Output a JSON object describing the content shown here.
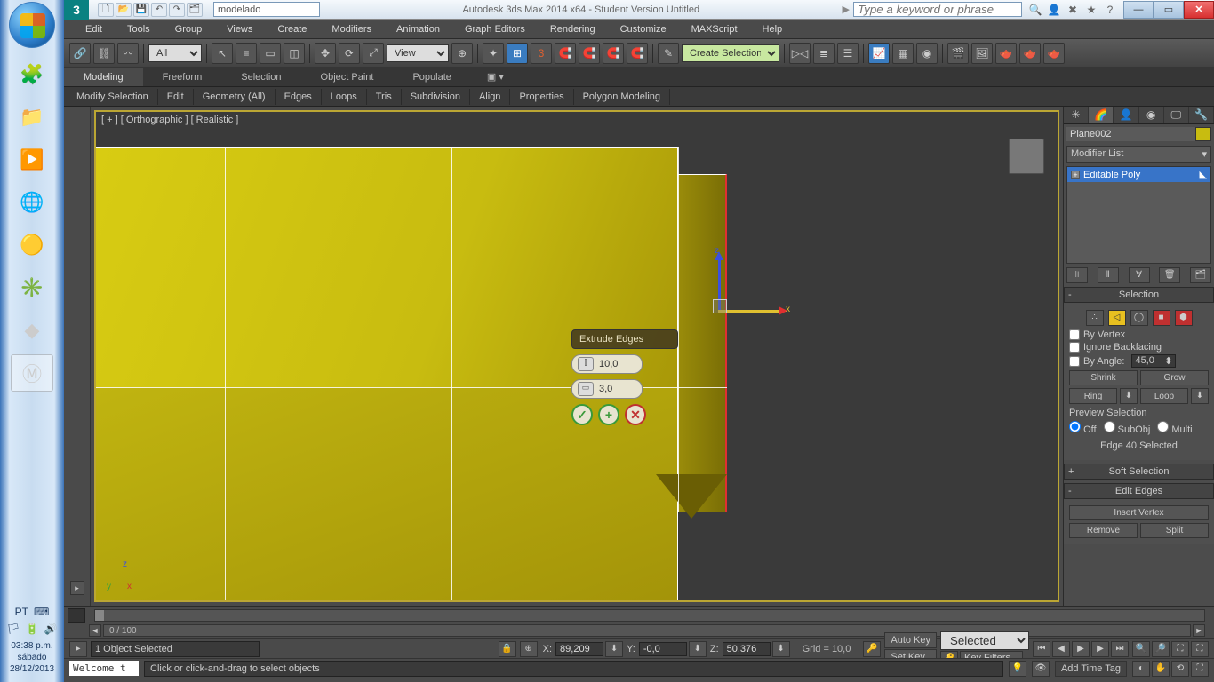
{
  "tray": {
    "lang": "PT",
    "time": "03:38 p.m.",
    "day": "sábado",
    "date": "28/12/2013"
  },
  "titlebar": {
    "workspace": "modelado",
    "title": "Autodesk 3ds Max  2014 x64  - Student Version    Untitled",
    "search_ph": "Type a keyword or phrase"
  },
  "menubar": [
    "Edit",
    "Tools",
    "Group",
    "Views",
    "Create",
    "Modifiers",
    "Animation",
    "Graph Editors",
    "Rendering",
    "Customize",
    "MAXScript",
    "Help"
  ],
  "maintoolbar": {
    "filter": "All",
    "refcoord": "View",
    "named_sel": "Create Selection Se"
  },
  "ribbon_tabs": [
    "Modeling",
    "Freeform",
    "Selection",
    "Object Paint",
    "Populate"
  ],
  "sub_ribbon": [
    "Modify Selection",
    "Edit",
    "Geometry (All)",
    "Edges",
    "Loops",
    "Tris",
    "Subdivision",
    "Align",
    "Properties",
    "Polygon Modeling"
  ],
  "viewport": {
    "label": "[ + ] [ Orthographic ] [ Realistic ]",
    "caddy_title": "Extrude Edges",
    "caddy_v1": "10,0",
    "caddy_v2": "3,0",
    "axis_z": "z",
    "axis_x": "x",
    "axis_y": "y"
  },
  "cmd": {
    "obj": "Plane002",
    "mod_list": "Modifier List",
    "stack": "Editable Poly",
    "selection": "Selection",
    "by_vertex": "By Vertex",
    "ignore_bf": "Ignore Backfacing",
    "by_angle": "By Angle:",
    "angle_v": "45,0",
    "shrink": "Shrink",
    "grow": "Grow",
    "ring": "Ring",
    "loop": "Loop",
    "preview": "Preview Selection",
    "off": "Off",
    "subobj": "SubObj",
    "multi": "Multi",
    "sel_status": "Edge 40 Selected",
    "soft_sel": "Soft Selection",
    "edit_edges": "Edit Edges",
    "insert_v": "Insert Vertex",
    "remove": "Remove",
    "split": "Split"
  },
  "timeline": {
    "range": "0 / 100"
  },
  "status": {
    "sel": "1 Object Selected",
    "x": "89,209",
    "y": "-0,0",
    "z": "50,376",
    "grid": "Grid = 10,0",
    "auto": "Auto Key",
    "set": "Set Key",
    "selected": "Selected",
    "kf": "Key Filters..."
  },
  "prompt": {
    "welcome": "Welcome t",
    "hint": "Click or click-and-drag to select objects",
    "timetag": "Add Time Tag"
  }
}
